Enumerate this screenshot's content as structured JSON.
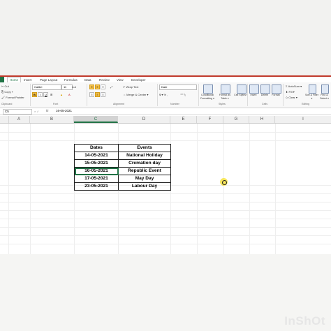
{
  "ribbon_tabs": [
    "Home",
    "Insert",
    "Page Layout",
    "Formulas",
    "Data",
    "Review",
    "View",
    "Developer"
  ],
  "clipboard": {
    "cut": "Cut",
    "copy": "Copy ▾",
    "format_painter": "Format Painter",
    "group": "Clipboard"
  },
  "font": {
    "name": "Calibri",
    "size": "11",
    "group": "Font"
  },
  "alignment": {
    "wrap": "Wrap Text",
    "merge": "Merge & Center ▾",
    "group": "Alignment"
  },
  "number": {
    "format": "Date",
    "group": "Number"
  },
  "styles": {
    "conditional": "Conditional Formatting ▾",
    "format_table": "Format as Table ▾",
    "cell_styles": "Cell Styles ▾",
    "group": "Styles"
  },
  "cells": {
    "insert": "Insert",
    "delete": "Delete",
    "format": "Format",
    "group": "Cells"
  },
  "editing": {
    "autosum": "AutoSum ▾",
    "fill": "Fill ▾",
    "clear": "Clear ▾",
    "sort": "Sort & Filter ▾",
    "find": "Find & Select ▾",
    "group": "Editing"
  },
  "formula_bar": {
    "name_box": "C5",
    "fx": "fx",
    "value": "16-05-2021"
  },
  "columns": [
    "A",
    "B",
    "C",
    "D",
    "E",
    "F",
    "G",
    "H",
    "I"
  ],
  "table": {
    "headers": [
      "Dates",
      "Events"
    ],
    "rows": [
      [
        "14-05-2021",
        "National Holiday"
      ],
      [
        "15-05-2021",
        "Cremation day"
      ],
      [
        "16-05-2021",
        "Republic Event"
      ],
      [
        "17-05-2021",
        "May Day"
      ],
      [
        "23-05-2021",
        "Labour Day"
      ]
    ]
  },
  "watermark": "InShOt"
}
